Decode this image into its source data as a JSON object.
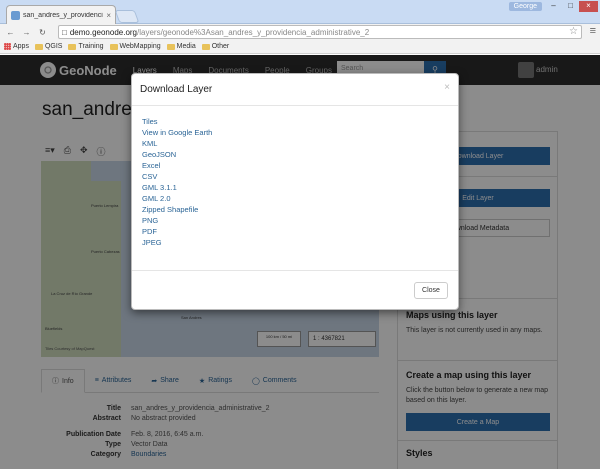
{
  "browser": {
    "tab_title": "san_andres_y_providencia",
    "tab_close": "×",
    "user": "George",
    "win_min": "–",
    "win_max": "□",
    "win_close": "×",
    "url_host": "demo.geonode.org",
    "url_path": "/layers/geonode%3Asan_andres_y_providencia_administrative_2",
    "bookmarks": [
      "Apps",
      "QGIS",
      "Training",
      "WebMapping",
      "Media",
      "Other"
    ]
  },
  "geonode": {
    "logo": "GeoNode",
    "nav": [
      "Layers",
      "Maps",
      "Documents",
      "People",
      "Groups"
    ],
    "search_placeholder": "Search",
    "user_label": "admin"
  },
  "page": {
    "title": "san_andres_y_providencia_administrative_2",
    "map": {
      "labels": [
        "Puerto Lempira",
        "Puerto Cabezas",
        "La Cruz de Río Grande",
        "Bluefields",
        "Tila Coloñas de MapQuest",
        "San Andres"
      ],
      "scale": "100 km / 50 mi",
      "ratio": "1 : 4367821",
      "attribution": "Tiles Courtesy of MapQuest"
    },
    "tabs": [
      "Info",
      "Attributes",
      "Share",
      "Ratings",
      "Comments"
    ],
    "info": [
      {
        "k": "Title",
        "v": "san_andres_y_providencia_administrative_2"
      },
      {
        "k": "Abstract",
        "v": "No abstract provided"
      },
      {
        "k": "Publication Date",
        "v": "Feb. 8, 2016, 6:45 a.m."
      },
      {
        "k": "Type",
        "v": "Vector Data"
      },
      {
        "k": "Category",
        "v": "Boundaries"
      }
    ]
  },
  "sidebar": {
    "download_layer": "Download Layer",
    "edit_layer": "Edit Layer",
    "download_metadata": "Download Metadata",
    "maps_title": "Maps using this layer",
    "maps_text": "This layer is not currently used in any maps.",
    "create_title": "Create a map using this layer",
    "create_text": "Click the button below to generate a new map based on this layer.",
    "create_btn": "Create a Map",
    "styles_title": "Styles"
  },
  "modal": {
    "title": "Download Layer",
    "close_x": "×",
    "links": [
      "Tiles",
      "View in Google Earth",
      "KML",
      "GeoJSON",
      "Excel",
      "CSV",
      "GML 3.1.1",
      "GML 2.0",
      "Zipped Shapefile",
      "PNG",
      "PDF",
      "JPEG"
    ],
    "close_button": "Close"
  }
}
